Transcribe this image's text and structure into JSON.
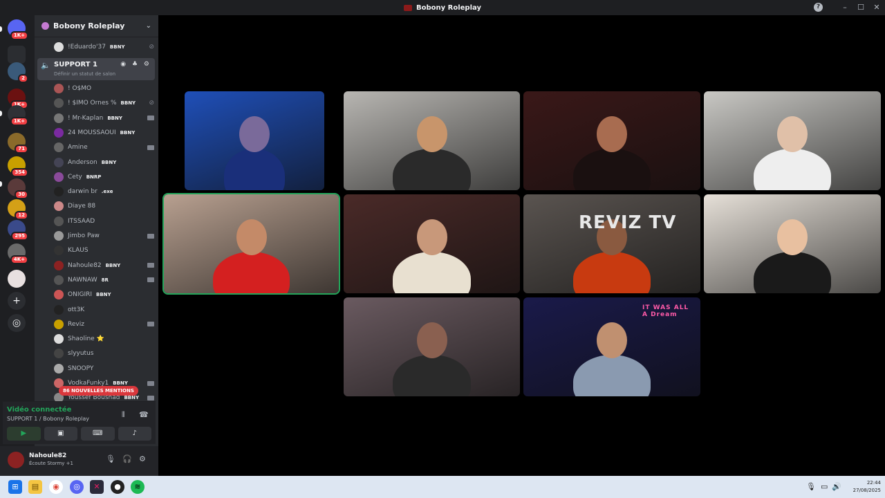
{
  "window": {
    "title": "Bobony Roleplay",
    "help": "?",
    "minimize": "–",
    "maximize": "☐",
    "close": "✕"
  },
  "servers": [
    {
      "badge": "1K+",
      "color": "#5865f2"
    },
    {
      "badge": "",
      "color": "#2b2d31"
    },
    {
      "badge": "2",
      "color": "#3a5a7a"
    },
    {
      "badge": "1K+",
      "color": "#6b1111"
    },
    {
      "badge": "1K+",
      "color": "#2f3136"
    },
    {
      "badge": "71",
      "color": "#8a6a2a"
    },
    {
      "badge": "354",
      "color": "#c8a000"
    },
    {
      "badge": "30",
      "color": "#5a3a3a"
    },
    {
      "badge": "12",
      "color": "#d4a017"
    },
    {
      "badge": "295",
      "color": "#3a4a8a"
    },
    {
      "badge": "4K+",
      "color": "#6a6a6a"
    },
    {
      "badge": "",
      "color": "#e8e0e0"
    }
  ],
  "guild": {
    "name": "Bobony Roleplay"
  },
  "members_above": [
    {
      "name": "!Eduardo'37",
      "tag": "BBNY"
    }
  ],
  "active_channel": {
    "name": "SUPPORT 1",
    "status": "Définir un statut de salon",
    "icons": "◉ ♣ ⚙"
  },
  "members": [
    {
      "name": "! O$MO",
      "tag": "",
      "icon": "",
      "color": "#a55"
    },
    {
      "name": "! $IMO Ornes %",
      "tag": "BBNY",
      "icon": "mute",
      "color": "#555"
    },
    {
      "name": "! Mr-Kaplan",
      "tag": "BBNY",
      "icon": "cam",
      "color": "#777"
    },
    {
      "name": "24 MOUSSAOUI",
      "tag": "BBNY",
      "icon": "",
      "color": "#7a2aa0"
    },
    {
      "name": "Amine",
      "tag": "",
      "icon": "cam",
      "color": "#666"
    },
    {
      "name": "Anderson",
      "tag": "BBNY",
      "icon": "",
      "color": "#445"
    },
    {
      "name": "Cety",
      "tag": "BNRP",
      "icon": "",
      "color": "#8a4a9a"
    },
    {
      "name": "darwin br",
      "tag": ".exe",
      "icon": "",
      "color": "#222"
    },
    {
      "name": "Diaye 88",
      "tag": "",
      "icon": "",
      "color": "#c88"
    },
    {
      "name": "ITSSAAD",
      "tag": "",
      "icon": "",
      "color": "#555"
    },
    {
      "name": "Jimbo Paw",
      "tag": "",
      "icon": "cam",
      "color": "#999"
    },
    {
      "name": "KLAUS",
      "tag": "",
      "icon": "",
      "color": "#333"
    },
    {
      "name": "Nahoule82",
      "tag": "BBNY",
      "icon": "cam",
      "color": "#8c2222"
    },
    {
      "name": "NAWNAW",
      "tag": "8R",
      "icon": "cam",
      "color": "#555"
    },
    {
      "name": "ONIGIRI",
      "tag": "BBNY",
      "icon": "",
      "color": "#c55"
    },
    {
      "name": "ott3K",
      "tag": "",
      "icon": "",
      "color": "#222"
    },
    {
      "name": "Reviz",
      "tag": "",
      "icon": "cam",
      "color": "#c9a000"
    },
    {
      "name": "Shaoline ⭐",
      "tag": "",
      "icon": "",
      "color": "#ddd"
    },
    {
      "name": "slyyutus",
      "tag": "",
      "icon": "",
      "color": "#444"
    },
    {
      "name": "SNOOPY",
      "tag": "",
      "icon": "",
      "color": "#aaa"
    },
    {
      "name": "VodkaFunky1",
      "tag": "BBNY",
      "icon": "cam",
      "color": "#c66"
    },
    {
      "name": "Youssef Boushad",
      "tag": "BBNY",
      "icon": "cam",
      "color": "#888"
    }
  ],
  "mentions": "86 NOUVELLES MENTIONS",
  "rtc": {
    "connected": "Vidéo connectée",
    "channel": "SUPPORT 1 / Bobony Roleplay"
  },
  "user": {
    "name": "Nahoule82",
    "activity": "Écoute Stormy +1"
  },
  "tiles": [
    {
      "bg": "#1f4fb8",
      "skin": "#7a6a9a",
      "shirt": "#1a2f7a",
      "overlay": ""
    },
    {
      "bg": "#b8b6b2",
      "skin": "#c8956b",
      "shirt": "#2a2a2a",
      "overlay": ""
    },
    {
      "bg": "#3a1818",
      "skin": "#a86c50",
      "shirt": "#1a1010",
      "overlay": ""
    },
    {
      "bg": "#c9c8c4",
      "skin": "#e0c0a8",
      "shirt": "#eeeeee",
      "overlay": ""
    },
    {
      "bg": "#b8a090",
      "skin": "#c48a68",
      "shirt": "#d42020",
      "overlay": ""
    },
    {
      "bg": "#4a2a28",
      "skin": "#c8987a",
      "shirt": "#e8e0d0",
      "overlay": ""
    },
    {
      "bg": "#5a5450",
      "skin": "#8a5a40",
      "shirt": "#c83a10",
      "overlay": "REVIZ TV"
    },
    {
      "bg": "#e6e0d8",
      "skin": "#e8c0a0",
      "shirt": "#1a1a1a",
      "overlay": ""
    },
    {
      "bg": "#6a5a60",
      "skin": "#8a6050",
      "shirt": "#2a2a2a",
      "overlay": ""
    },
    {
      "bg": "#1a1a4a",
      "skin": "#c09070",
      "shirt": "#8a9ab0",
      "overlay": "IT WAS ALL A Dream"
    }
  ],
  "clock": {
    "time": "22:44",
    "date": "27/08/2025"
  }
}
